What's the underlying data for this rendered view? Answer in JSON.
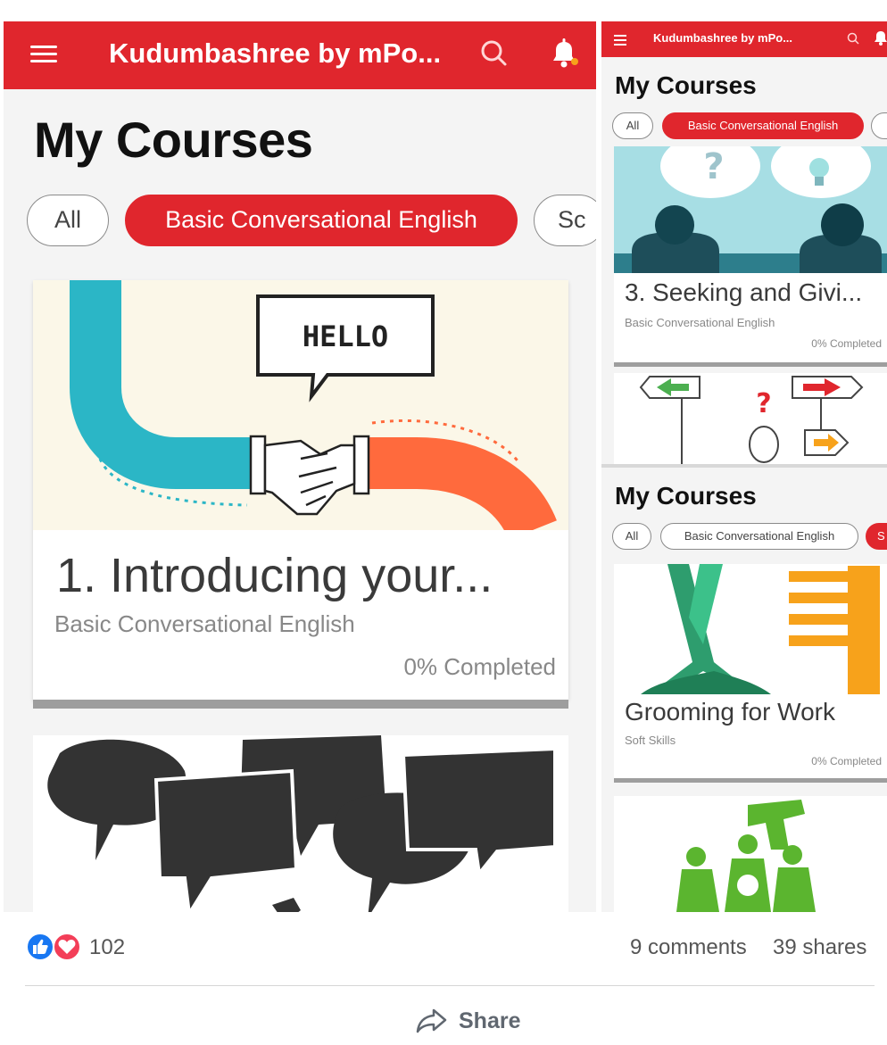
{
  "left_screen": {
    "app_title": "Kudumbashree by mPo...",
    "heading": "My Courses",
    "chips": [
      "All",
      "Basic Conversational English",
      "Sc"
    ],
    "card": {
      "image_text": "HELLO",
      "title": "1. Introducing your...",
      "subtitle": "Basic Conversational English",
      "progress_text": "0% Completed",
      "progress": 0
    }
  },
  "right_screen": {
    "app_title": "Kudumbashree by mPo...",
    "heading": "My Courses",
    "chips": [
      "All",
      "Basic Conversational English",
      ""
    ],
    "card1": {
      "title": "3. Seeking and Givi...",
      "subtitle": "Basic Conversational English",
      "progress_text": "0% Completed",
      "progress": 0
    }
  },
  "right_screen_2": {
    "heading": "My Courses",
    "chips": [
      "All",
      "Basic Conversational English",
      "S"
    ],
    "card1": {
      "title": "Grooming for Work",
      "subtitle": "Soft Skills",
      "progress_text": "0% Completed",
      "progress": 0
    }
  },
  "social": {
    "reaction_count": "102",
    "comments": "9 comments",
    "shares": "39 shares",
    "share_label": "Share"
  },
  "colors": {
    "brand_red": "#e0262d",
    "teal": "#2bb6c6",
    "orange": "#ff6a3d",
    "green": "#5bb52f",
    "like_blue": "#1877f2",
    "love_red": "#f33e58"
  }
}
